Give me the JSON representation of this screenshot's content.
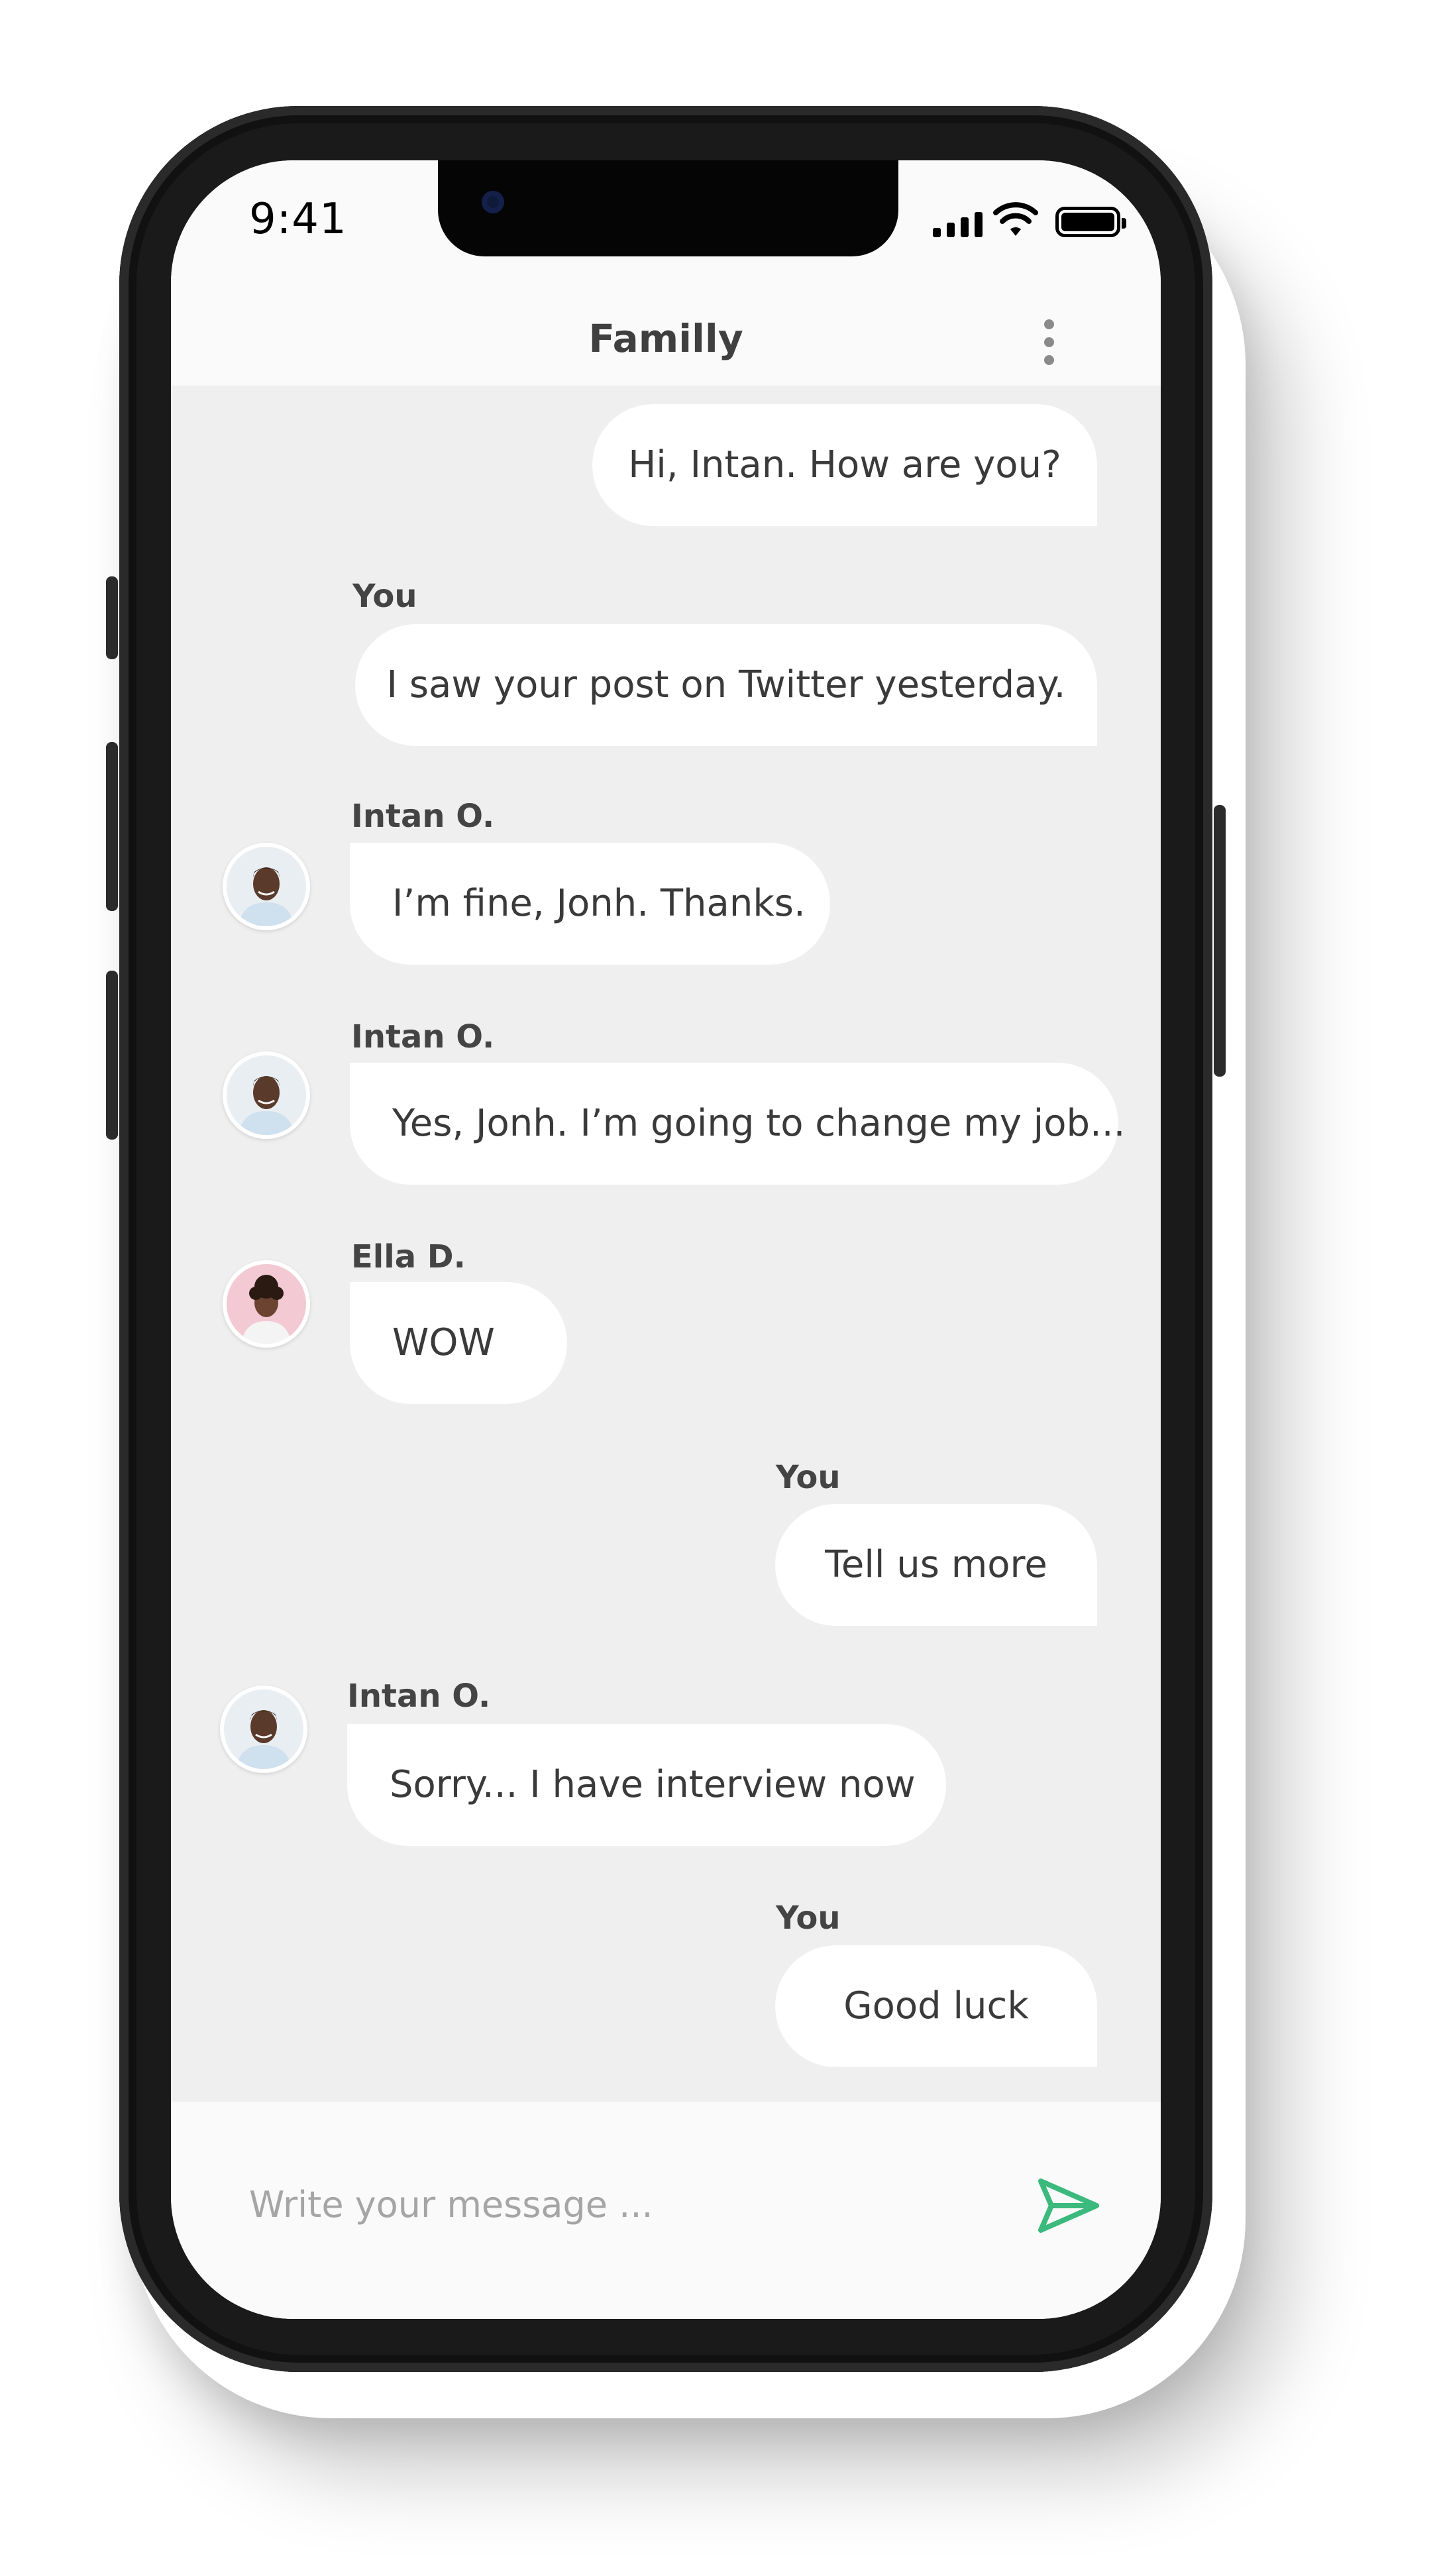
{
  "status": {
    "time": "9:41"
  },
  "header": {
    "title": "Familly",
    "menu_icon": "more-vertical-icon"
  },
  "messages": [
    {
      "from": "you",
      "sender": "",
      "text": "Hi, Intan. How are you?"
    },
    {
      "from": "you",
      "sender": "You",
      "text": "I saw your post on Twitter yesterday."
    },
    {
      "from": "other",
      "sender": "Intan O.",
      "text": "I’m fine, Jonh. Thanks.",
      "avatar": "intan"
    },
    {
      "from": "other",
      "sender": "Intan O.",
      "text": "Yes, Jonh. I’m going to change my job...",
      "avatar": "intan"
    },
    {
      "from": "other",
      "sender": "Ella D.",
      "text": "WOW",
      "avatar": "ella"
    },
    {
      "from": "you",
      "sender": "You",
      "text": "Tell us more"
    },
    {
      "from": "other",
      "sender": "Intan O.",
      "text": "Sorry... I have interview now",
      "avatar": "intan"
    },
    {
      "from": "you",
      "sender": "You",
      "text": "Good luck"
    }
  ],
  "composer": {
    "placeholder": "Write your message ...",
    "send_icon": "send-icon"
  },
  "colors": {
    "accent": "#3cb97c",
    "chat_bg": "#efefef",
    "bubble_bg": "#ffffff",
    "bar_bg": "#fafafa"
  }
}
